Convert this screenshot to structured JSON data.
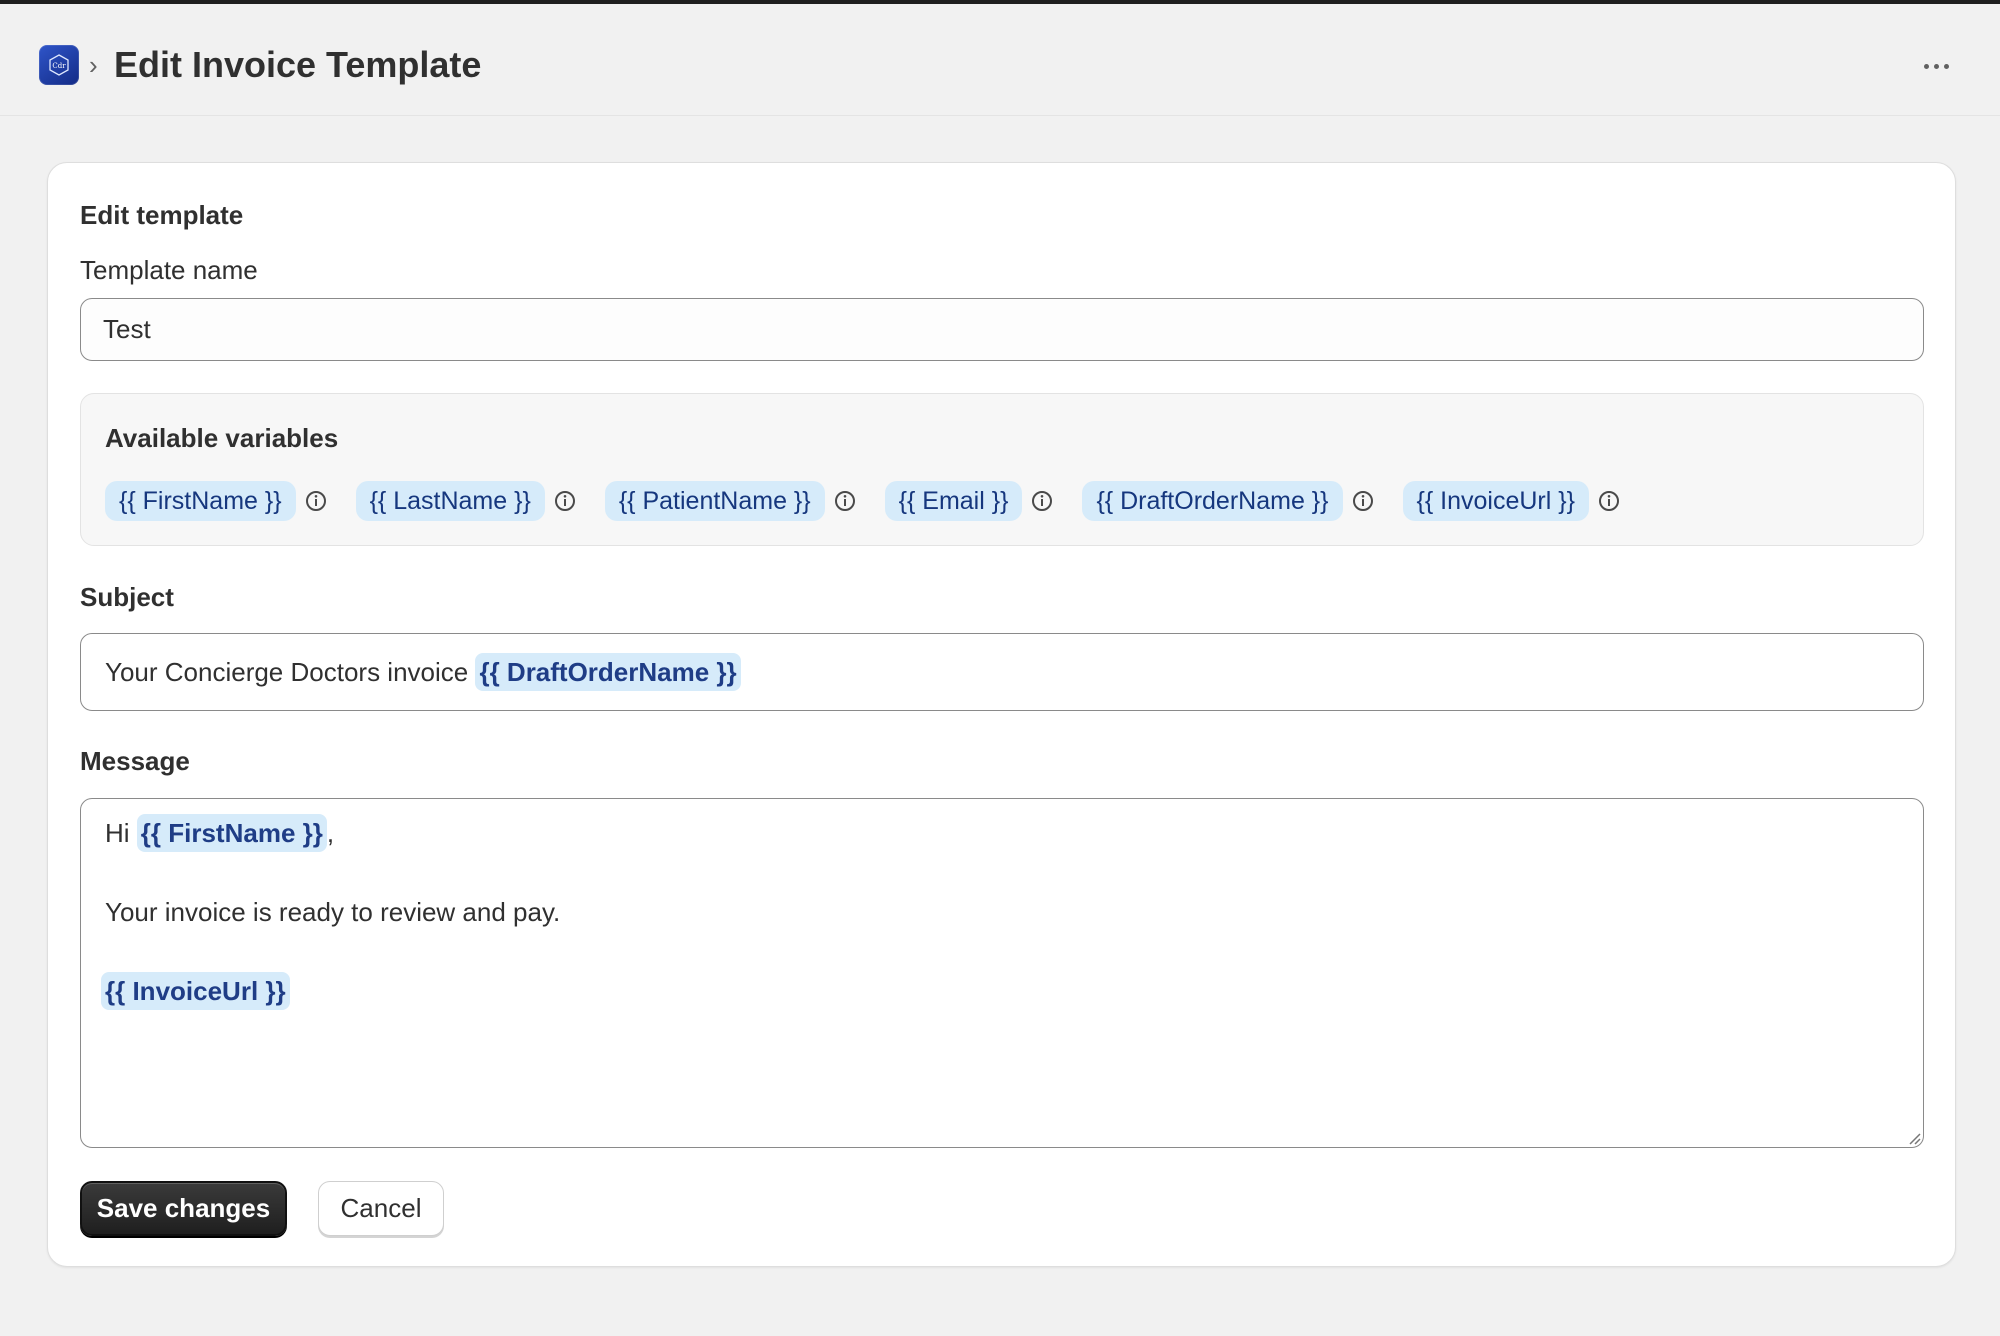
{
  "header": {
    "title": "Edit Invoice Template",
    "logo_icon": "app-logo-icon",
    "breadcrumb_icon": "chevron-right-icon",
    "more_icon": "more-horizontal-icon"
  },
  "card": {
    "title": "Edit template",
    "template_name": {
      "label": "Template name",
      "value": "Test"
    },
    "variables": {
      "heading": "Available variables",
      "items": [
        "{{ FirstName }}",
        "{{ LastName }}",
        "{{ PatientName }}",
        "{{ Email }}",
        "{{ DraftOrderName }}",
        "{{ InvoiceUrl }}"
      ]
    },
    "subject": {
      "label": "Subject",
      "text": "Your Concierge Doctors invoice ",
      "variable": "{{ DraftOrderName }}"
    },
    "message": {
      "label": "Message",
      "greeting": "Hi ",
      "greeting_variable": "{{ FirstName }}",
      "greeting_suffix": ",",
      "body": "Your invoice is ready to review and pay.",
      "link_variable": "{{ InvoiceUrl }}"
    },
    "buttons": {
      "save": "Save changes",
      "cancel": "Cancel"
    }
  },
  "colors": {
    "background": "#f1f1f1",
    "chip_bg": "#d6ebfa",
    "chip_text": "#16377e",
    "primary_button": "#303030"
  }
}
